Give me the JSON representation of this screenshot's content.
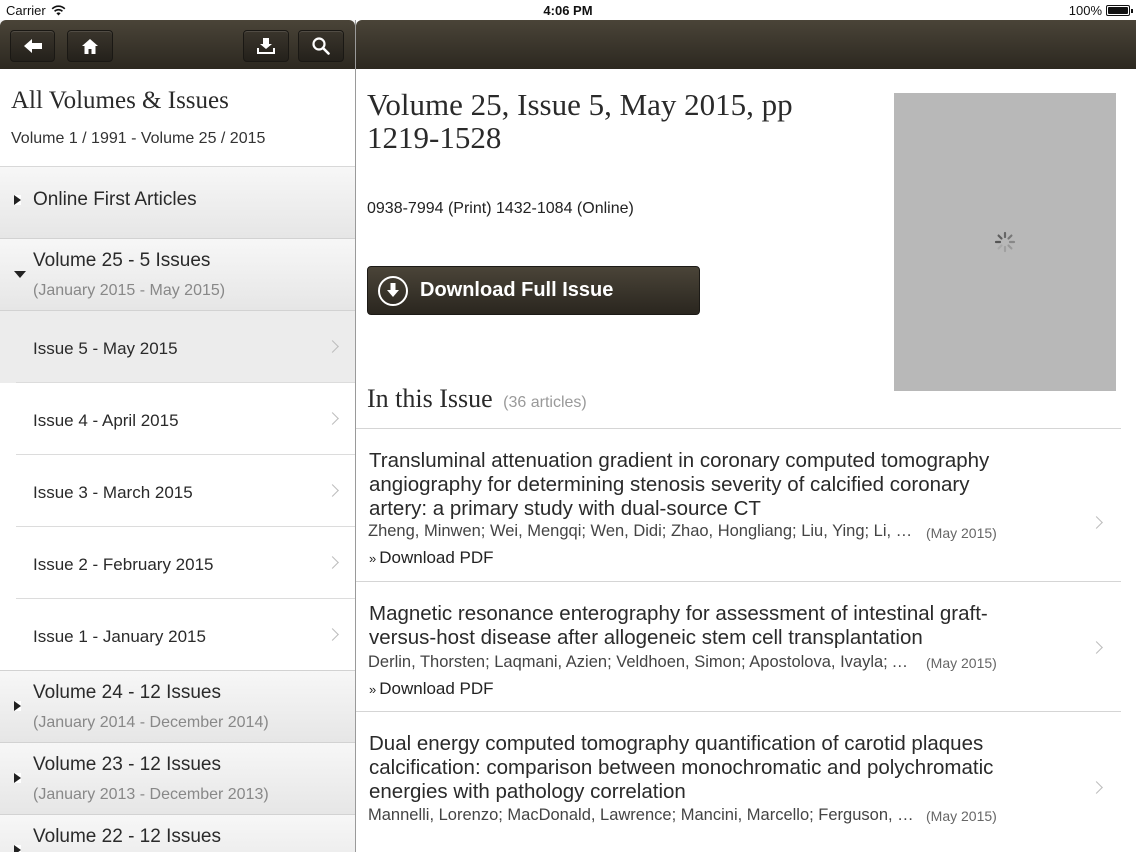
{
  "status": {
    "carrier": "Carrier",
    "time": "4:06 PM",
    "battery": "100%"
  },
  "toolbar": {
    "back_icon": "back-arrow-icon",
    "home_icon": "home-icon",
    "download_icon": "download-tray-icon",
    "search_icon": "search-icon"
  },
  "library": {
    "title": "All Volumes & Issues",
    "range": "Volume 1 / 1991 - Volume 25 / 2015",
    "online_first": "Online First Articles",
    "volume25": {
      "title": "Volume 25 - 5 Issues",
      "range": "(January 2015 - May 2015)"
    },
    "issues": [
      {
        "label": "Issue 5 - May 2015"
      },
      {
        "label": "Issue 4 - April 2015"
      },
      {
        "label": "Issue 3 - March 2015"
      },
      {
        "label": "Issue 2 - February 2015"
      },
      {
        "label": "Issue 1 - January 2015"
      }
    ],
    "volume24": {
      "title": "Volume 24 - 12 Issues",
      "range": "(January 2014 - December 2014)"
    },
    "volume23": {
      "title": "Volume 23 - 12 Issues",
      "range": "(January 2013 - December 2013)"
    },
    "volume22": {
      "title": "Volume 22 - 12 Issues"
    }
  },
  "issue": {
    "title": "Volume 25, Issue 5, May 2015, pp 1219-1528",
    "issn": "0938-7994 (Print) 1432-1084 (Online)",
    "download_label": "Download Full Issue",
    "in_this_issue": "In this Issue",
    "article_count": "(36 articles)"
  },
  "articles": [
    {
      "title": "Transluminal attenuation gradient in coronary computed tomography angiography for determining stenosis severity of calcified coronary artery: a primary study with dual-source CT",
      "authors": "Zheng, Minwen; Wei, Mengqi; Wen, Didi; Zhao, Hongliang; Liu, Ying; Li, Jiayi",
      "date": "(May 2015)",
      "pdf": "Download PDF"
    },
    {
      "title": "Magnetic resonance enterography for assessment of intestinal graft-versus-host disease after allogeneic stem cell transplantation",
      "authors": "Derlin, Thorsten; Laqmani, Azien; Veldhoen, Simon; Apostolova, Ivayla; Ayuk",
      "date": "(May 2015)",
      "pdf": "Download PDF"
    },
    {
      "title": "Dual energy computed tomography quantification of carotid plaques calcification: comparison between monochromatic and polychromatic energies with pathology correlation",
      "authors": "Mannelli, Lorenzo; MacDonald, Lawrence; Mancini, Marcello; Ferguson, Mark",
      "date": "(May 2015)"
    }
  ]
}
